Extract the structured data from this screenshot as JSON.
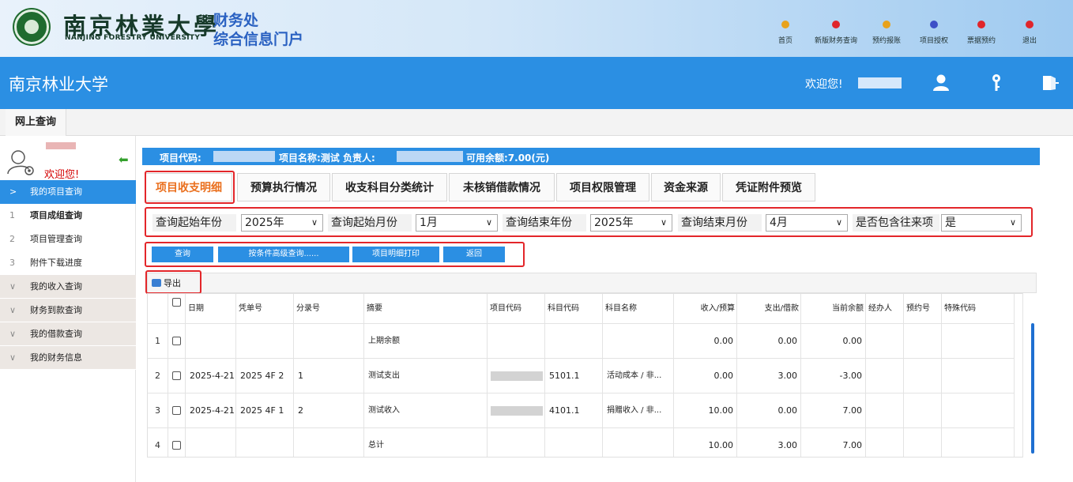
{
  "header": {
    "school_cn": "南京林業大學",
    "school_en": "NANJING FORESTRY UNIVERSITY",
    "dept_line1": "财务处",
    "dept_line2": "综合信息门户",
    "nav": [
      {
        "label": "首页",
        "color": "#e8a21b"
      },
      {
        "label": "新版财务查询",
        "color": "#e0252b"
      },
      {
        "label": "预约报账",
        "color": "#e8a21b"
      },
      {
        "label": "项目授权",
        "color": "#3d4fc7"
      },
      {
        "label": "票据预约",
        "color": "#e0252b"
      },
      {
        "label": "退出",
        "color": "#e0252b"
      }
    ]
  },
  "bluebar": {
    "system_title": "南京林业大学",
    "welcome": "欢迎您!",
    "icons": [
      "user-icon",
      "key-icon",
      "logout-icon"
    ]
  },
  "tabstrip": {
    "online_query": "网上查询"
  },
  "sidebar": {
    "welcome": "欢迎您!",
    "items": [
      {
        "icon": ">",
        "label": "我的项目查询",
        "style": "active"
      },
      {
        "icon": "1",
        "label": "项目成组查询",
        "style": "sub-bold"
      },
      {
        "icon": "2",
        "label": "项目管理查询",
        "style": "sub"
      },
      {
        "icon": "3",
        "label": "附件下载进度",
        "style": "sub"
      },
      {
        "icon": "∨",
        "label": "我的收入查询",
        "style": "group"
      },
      {
        "icon": "∨",
        "label": "财务到款查询",
        "style": "group"
      },
      {
        "icon": "∨",
        "label": "我的借款查询",
        "style": "group"
      },
      {
        "icon": "∨",
        "label": "我的财务信息",
        "style": "group"
      }
    ]
  },
  "infobar": {
    "code_label": "项目代码:",
    "name_label": "项目名称:测试 负责人:",
    "balance_label": "可用余额:7.00(元)"
  },
  "tabs": [
    "项目收支明细",
    "预算执行情况",
    "收支科目分类统计",
    "未核销借款情况",
    "项目权限管理",
    "资金来源",
    "凭证附件预览"
  ],
  "filters": {
    "start_year_label": "查询起始年份",
    "start_year": "2025年",
    "start_month_label": "查询起始月份",
    "start_month": "1月",
    "end_year_label": "查询结束年份",
    "end_year": "2025年",
    "end_month_label": "查询结束月份",
    "end_month": "4月",
    "include_label": "是否包含往来项",
    "include": "是"
  },
  "actions": [
    "查询",
    "按条件高级查询......",
    "项目明细打印",
    "返回"
  ],
  "toolbar": {
    "export": "导出"
  },
  "table": {
    "headers": [
      "日期",
      "凭单号",
      "分录号",
      "摘要",
      "项目代码",
      "科目代码",
      "科目名称",
      "收入/预算",
      "支出/借款",
      "当前余额",
      "经办人",
      "预约号",
      "特殊代码"
    ],
    "rows": [
      {
        "n": "1",
        "date": "",
        "voucher": "",
        "entry": "",
        "summary": "上期余额",
        "code": "",
        "subj_code": "",
        "subj_name": "",
        "income": "0.00",
        "expense": "0.00",
        "balance": "0.00"
      },
      {
        "n": "2",
        "date": "2025-4-21",
        "voucher": "2025 4F 2",
        "entry": "1",
        "summary": "测试支出",
        "code": "",
        "subj_code": "5101.1",
        "subj_name": "活动成本 / 非...",
        "income": "0.00",
        "expense": "3.00",
        "balance": "-3.00"
      },
      {
        "n": "3",
        "date": "2025-4-21",
        "voucher": "2025 4F 1",
        "entry": "2",
        "summary": "测试收入",
        "code": "",
        "subj_code": "4101.1",
        "subj_name": "捐赠收入 / 非...",
        "income": "10.00",
        "expense": "0.00",
        "balance": "7.00"
      },
      {
        "n": "4",
        "date": "",
        "voucher": "",
        "entry": "",
        "summary": "总计",
        "code": "",
        "subj_code": "",
        "subj_name": "",
        "income": "10.00",
        "expense": "3.00",
        "balance": "7.00"
      }
    ]
  }
}
